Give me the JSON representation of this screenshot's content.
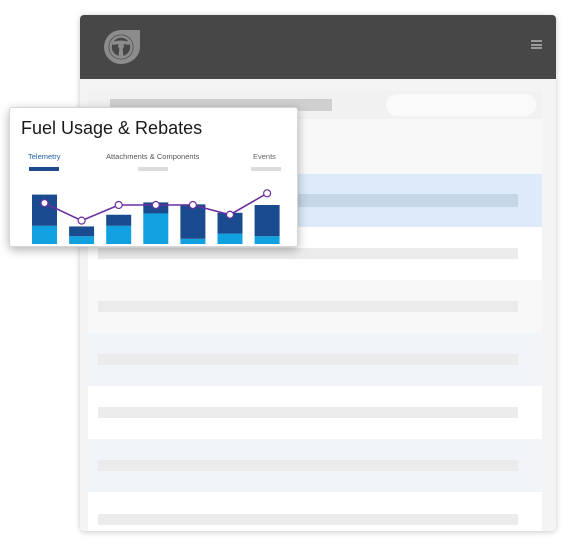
{
  "card": {
    "title": "Fuel Usage & Rebates",
    "tabs": [
      {
        "label": "Telemetry",
        "active": true
      },
      {
        "label": "Attachments & Components",
        "active": false
      },
      {
        "label": "Events",
        "active": false
      }
    ]
  },
  "header": {
    "logo_icon": "steering-wheel-logo-icon",
    "menu_icon": "hamburger-menu-icon"
  },
  "colors": {
    "header_bg": "#474747",
    "dark_blue": "#1a4b8f",
    "light_blue": "#11a0e0",
    "line_purple": "#6b2fa0",
    "selected_row": "#dceaf9"
  },
  "chart_data": {
    "type": "bar",
    "categories": [
      "",
      "",
      "",
      "",
      "",
      "",
      ""
    ],
    "series": [
      {
        "values": [
          0.28,
          0.12,
          0.28,
          0.47,
          0.08,
          0.16,
          0.12
        ]
      },
      {
        "values": [
          0.48,
          0.15,
          0.17,
          0.17,
          0.53,
          0.32,
          0.48
        ]
      },
      {
        "values": [
          0.63,
          0.36,
          0.6,
          0.6,
          0.6,
          0.45,
          0.78
        ]
      }
    ],
    "ylim": [
      0,
      1
    ]
  }
}
